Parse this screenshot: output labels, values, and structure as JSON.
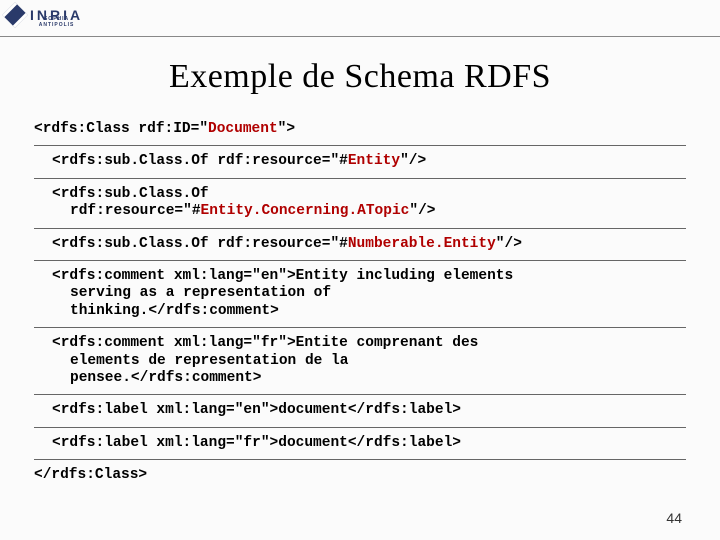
{
  "logo": {
    "text": "INRIA",
    "sub": "SOPHIA ANTIPOLIS"
  },
  "title": "Exemple de Schema RDFS",
  "page_number": "44",
  "code": {
    "l1a": "<rdfs:Class rdf:ID=\"",
    "l1b": "Document",
    "l1c": "\">",
    "l2a": "<rdfs:sub.Class.Of rdf:resource=\"#",
    "l2b": "Entity",
    "l2c": "\"/>",
    "l3a": "<rdfs:sub.Class.Of",
    "l3b": "rdf:resource=\"#",
    "l3c": "Entity.Concerning.ATopic",
    "l3d": "\"/>",
    "l4a": "<rdfs:sub.Class.Of rdf:resource=\"#",
    "l4b": "Numberable.Entity",
    "l4c": "\"/>",
    "l5a": "<rdfs:comment xml:lang=\"en\">Entity including elements",
    "l5b": "serving as a representation of",
    "l5c": "thinking.</rdfs:comment>",
    "l6a": "<rdfs:comment xml:lang=\"fr\">Entite comprenant des",
    "l6b": "elements de representation de la",
    "l6c": "pensee.</rdfs:comment>",
    "l7": "<rdfs:label xml:lang=\"en\">document</rdfs:label>",
    "l8": "<rdfs:label xml:lang=\"fr\">document</rdfs:label>",
    "l9": "</rdfs:Class>"
  }
}
